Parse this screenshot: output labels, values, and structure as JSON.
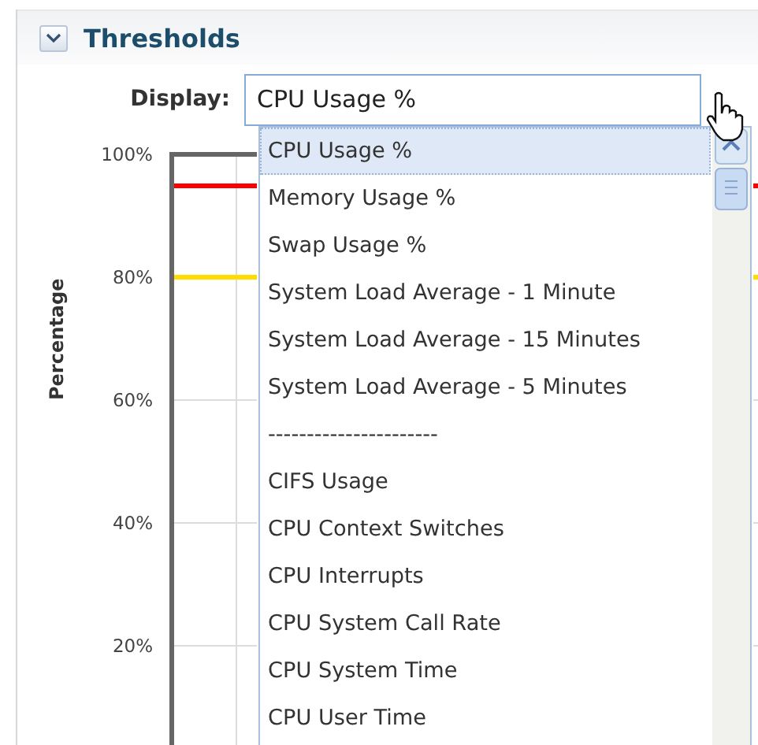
{
  "section": {
    "title": "Thresholds",
    "expanded": true
  },
  "display": {
    "label": "Display:",
    "value": "CPU Usage %"
  },
  "dropdown": {
    "options": [
      {
        "label": "CPU Usage %",
        "selected": true
      },
      {
        "label": "Memory Usage %",
        "selected": false
      },
      {
        "label": "Swap Usage %",
        "selected": false
      },
      {
        "label": "System Load Average - 1 Minute",
        "selected": false
      },
      {
        "label": "System Load Average - 15 Minutes",
        "selected": false
      },
      {
        "label": "System Load Average - 5 Minutes",
        "selected": false
      },
      {
        "label": "----------------------",
        "selected": false
      },
      {
        "label": "CIFS Usage",
        "selected": false
      },
      {
        "label": "CPU Context Switches",
        "selected": false
      },
      {
        "label": "CPU Interrupts",
        "selected": false
      },
      {
        "label": "CPU System Call Rate",
        "selected": false
      },
      {
        "label": "CPU System Time",
        "selected": false
      },
      {
        "label": "CPU User Time",
        "selected": false
      }
    ]
  },
  "chart": {
    "y_axis_title": "Percentage",
    "y_tick_labels": [
      "100%",
      "80%",
      "60%",
      "40%",
      "20%"
    ],
    "threshold_lines": [
      {
        "color": "#ff0000"
      },
      {
        "color": "#ffdd00"
      }
    ]
  }
}
